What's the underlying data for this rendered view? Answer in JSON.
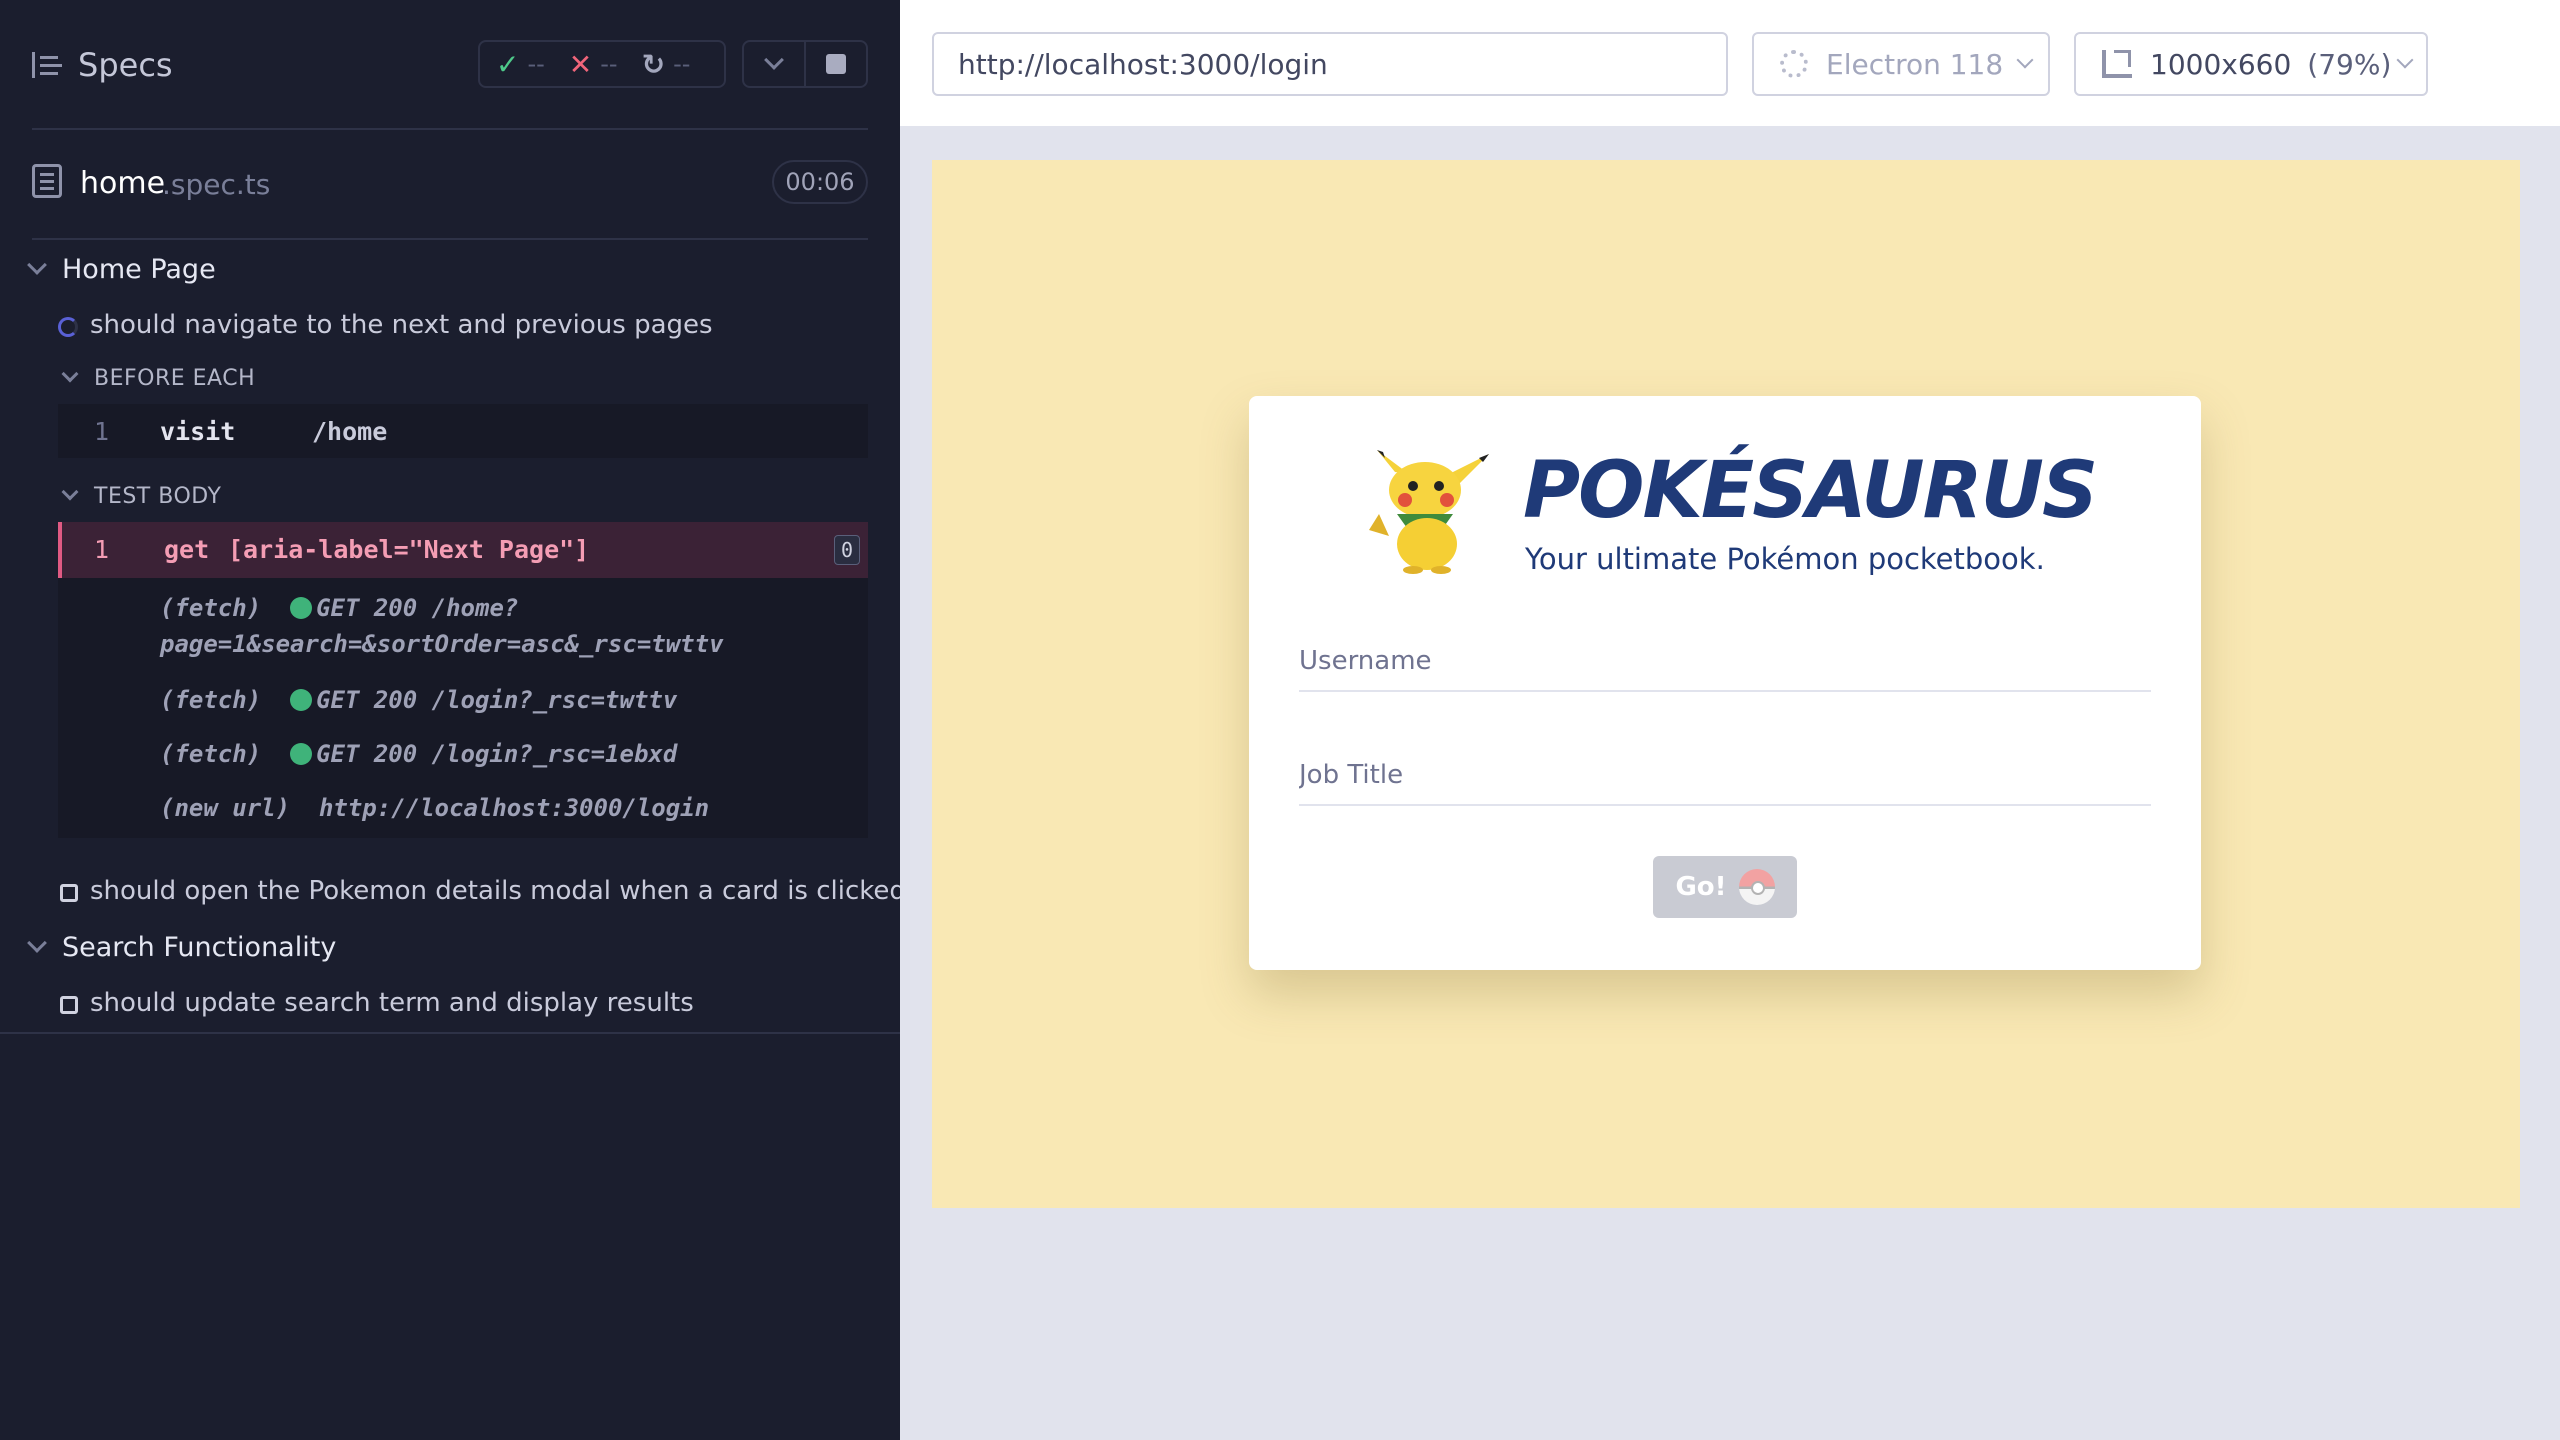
{
  "reporter": {
    "title": "Specs",
    "stats": {
      "passed": "--",
      "failed": "--",
      "pending": "--"
    },
    "spec": {
      "name": "home",
      "ext": ".spec.ts",
      "duration": "00:06"
    },
    "suites": [
      {
        "title": "Home Page"
      },
      {
        "title": "Search Functionality"
      }
    ],
    "tests": [
      {
        "title": "should navigate to the next and previous pages"
      },
      {
        "title": "should open the Pokemon details modal when a card is clicked"
      },
      {
        "title": "should update search term and display results"
      }
    ],
    "hooks": {
      "before_each": "BEFORE EACH",
      "test_body": "TEST BODY"
    },
    "commands": [
      {
        "num": "1",
        "name": "visit",
        "message": "/home"
      },
      {
        "num": "1",
        "name": "get",
        "message": "[aria-label=\"Next Page\"]",
        "badge": "0"
      }
    ],
    "logs": [
      {
        "type": "(fetch)",
        "text": "GET 200 /home?",
        "cont": "page=1&search=&sortOrder=asc&_rsc=twttv"
      },
      {
        "type": "(fetch)",
        "text": "GET 200 /login?_rsc=twttv"
      },
      {
        "type": "(fetch)",
        "text": "GET 200 /login?_rsc=1ebxd"
      },
      {
        "type": "(new url)",
        "text": "http://localhost:3000/login"
      }
    ]
  },
  "aut": {
    "url": "http://localhost:3000/login",
    "browser": "Electron 118",
    "viewport": "1000x660",
    "scale": "(79%)"
  },
  "app": {
    "brand": "POKÉSAURUS",
    "tagline": "Your ultimate Pokémon pocketbook.",
    "username_placeholder": "Username",
    "job_title_placeholder": "Job Title",
    "go_label": "Go!"
  },
  "colors": {
    "reporter_bg": "#1b1e2e",
    "active_command": "#3b2236",
    "viewport_bg": "#f9e8b4",
    "brand": "#1f3a78"
  }
}
